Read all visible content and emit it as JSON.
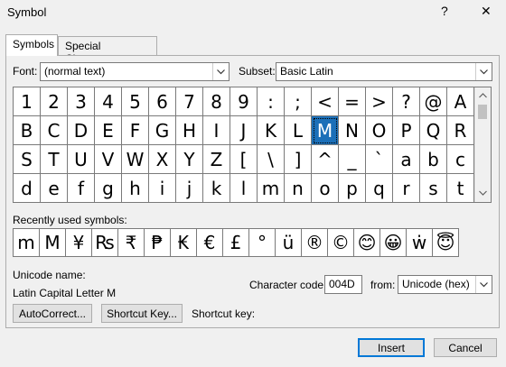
{
  "window": {
    "title": "Symbol",
    "help": "?",
    "close": "✕"
  },
  "tabs": [
    {
      "label": "Symbols"
    },
    {
      "label": "Special Characters"
    }
  ],
  "font": {
    "label": "Font:",
    "value": "(normal text)"
  },
  "subset": {
    "label": "Subset:",
    "value": "Basic Latin"
  },
  "grid": {
    "rows": [
      [
        "1",
        "2",
        "3",
        "4",
        "5",
        "6",
        "7",
        "8",
        "9",
        ":",
        ";",
        "<",
        "=",
        ">",
        "?",
        "@",
        "A"
      ],
      [
        "B",
        "C",
        "D",
        "E",
        "F",
        "G",
        "H",
        "I",
        "J",
        "K",
        "L",
        "M",
        "N",
        "O",
        "P",
        "Q",
        "R"
      ],
      [
        "S",
        "T",
        "U",
        "V",
        "W",
        "X",
        "Y",
        "Z",
        "[",
        "\\",
        "]",
        "^",
        "_",
        "`",
        "a",
        "b",
        "c"
      ],
      [
        "d",
        "e",
        "f",
        "g",
        "h",
        "i",
        "j",
        "k",
        "l",
        "m",
        "n",
        "o",
        "p",
        "q",
        "r",
        "s",
        "t"
      ]
    ],
    "selected_row": 1,
    "selected_col": 11
  },
  "recent": {
    "label": "Recently used symbols:",
    "symbols": [
      "m",
      "M",
      "¥",
      "₨",
      "₹",
      "₱",
      "₭",
      "€",
      "£",
      "°",
      "ü",
      "®",
      "©",
      "😊",
      "😀",
      "ẇ",
      "😇"
    ]
  },
  "unicode": {
    "name_label": "Unicode name:",
    "name_value": "Latin Capital Letter M"
  },
  "charcode": {
    "label": "Character code:",
    "value": "004D",
    "from_label": "from:",
    "from_value": "Unicode (hex)"
  },
  "buttons": {
    "autocorrect": "AutoCorrect...",
    "shortcut_key": "Shortcut Key...",
    "shortcut_label": "Shortcut key:",
    "insert": "Insert",
    "cancel": "Cancel"
  }
}
